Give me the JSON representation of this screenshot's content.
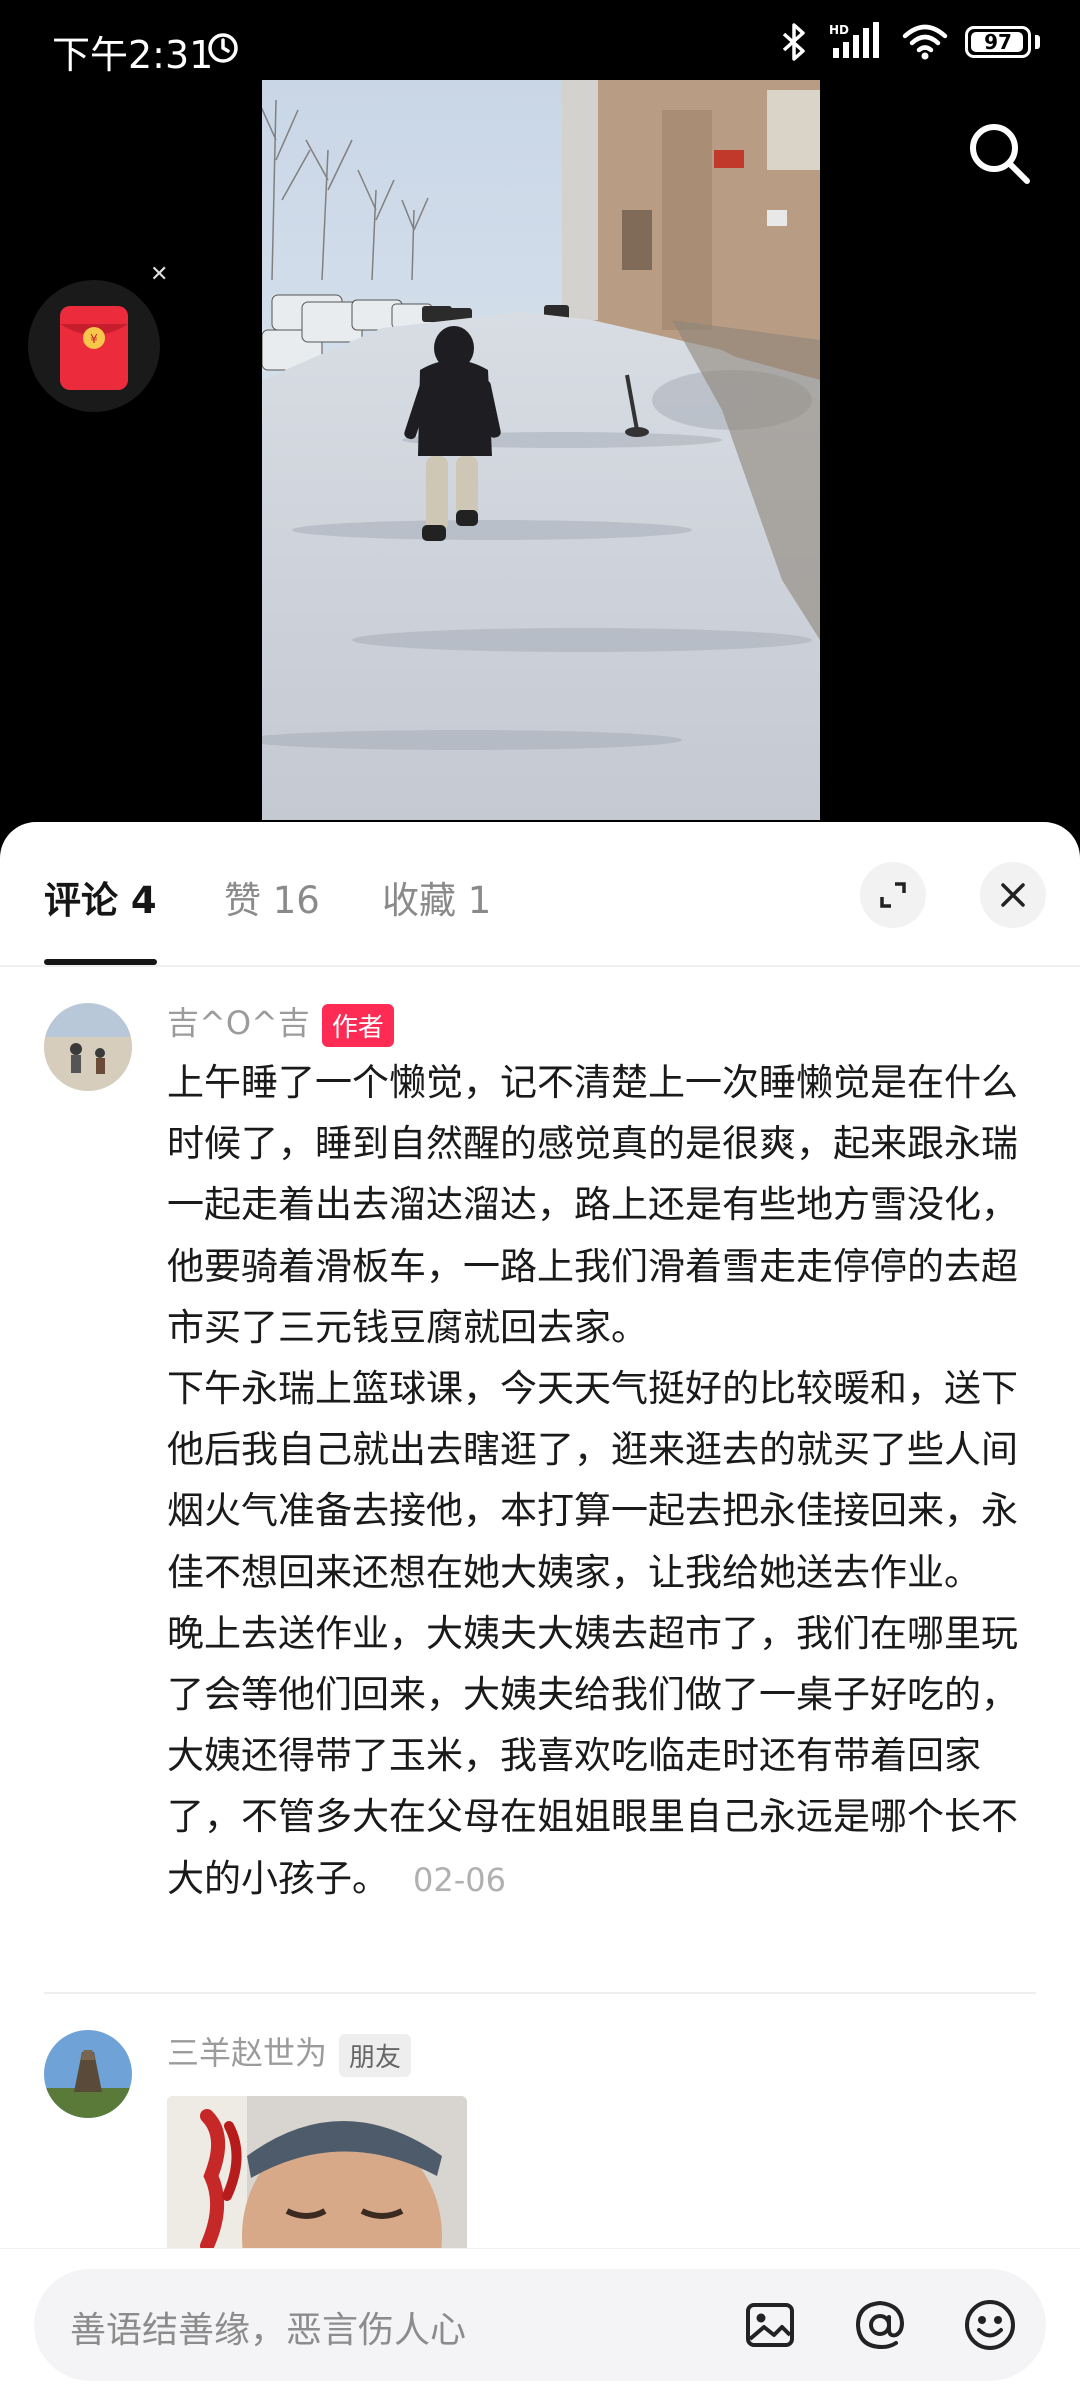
{
  "status_bar": {
    "time": "下午2:31",
    "battery": "97",
    "battery_level_percent": 97,
    "icons": [
      "alarm-icon",
      "bluetooth-icon",
      "hd-signal-icon",
      "wifi-icon",
      "battery-icon"
    ]
  },
  "video": {
    "overlay_icons": [
      "search-icon",
      "red-packet-icon",
      "close-icon"
    ]
  },
  "tabs": [
    {
      "label": "评论 4",
      "active": true
    },
    {
      "label": "赞 16",
      "active": false
    },
    {
      "label": "收藏 1",
      "active": false
    }
  ],
  "header_icons": [
    "expand-icon",
    "close-icon"
  ],
  "comments": [
    {
      "username": "吉^O^吉",
      "badge": "作者",
      "paragraphs": [
        "上午睡了一个懒觉，记不清楚上一次睡懒觉是在什么时候了，睡到自然醒的感觉真的是很爽，起来跟永瑞一起走着出去溜达溜达，路上还是有些地方雪没化，他要骑着滑板车，一路上我们滑着雪走走停停的去超市买了三元钱豆腐就回去家。",
        "下午永瑞上篮球课，今天天气挺好的比较暖和，送下他后我自己就出去瞎逛了，逛来逛去的就买了些人间烟火气准备去接他，本打算一起去把永佳接回来，永佳不想回来还想在她大姨家，让我给她送去作业。",
        "晚上去送作业，大姨夫大姨去超市了，我们在哪里玩了会等他们回来，大姨夫给我们做了一桌子好吃的，大姨还得带了玉米，我喜欢吃临走时还有带着回家了，不管多大在父母在姐姐眼里自己永远是哪个长不大的小孩子。"
      ],
      "date": "02-06"
    },
    {
      "username": "三羊赵世为",
      "badge": "朋友"
    }
  ],
  "input": {
    "placeholder": "善语结善缘，恶言伤人心",
    "icons": [
      "image-icon",
      "at-icon",
      "emoji-icon"
    ]
  },
  "colors": {
    "accent": "#fe2c55",
    "text_primary": "#161616",
    "text_secondary": "#9b9b9b"
  }
}
